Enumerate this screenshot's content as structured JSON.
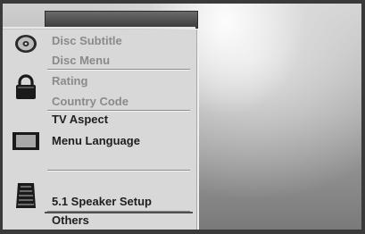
{
  "menu": {
    "items": [
      {
        "label": "Disc Subtitle"
      },
      {
        "label": "Disc Menu"
      },
      {
        "label": "Rating"
      },
      {
        "label": "Country Code"
      },
      {
        "label": "TV Aspect"
      },
      {
        "label": "Menu Language"
      },
      {
        "label": "5.1 Speaker Setup"
      },
      {
        "label": "Others"
      }
    ]
  },
  "icons": [
    "disc-icon",
    "padlock-icon",
    "tv-icon",
    "speaker-icon"
  ],
  "colors": {
    "menu_background": "#d8d8d8",
    "dim_text": "#8a8a8a",
    "normal_text": "#1e1e1e",
    "title_bar": "#4a4a4a"
  }
}
